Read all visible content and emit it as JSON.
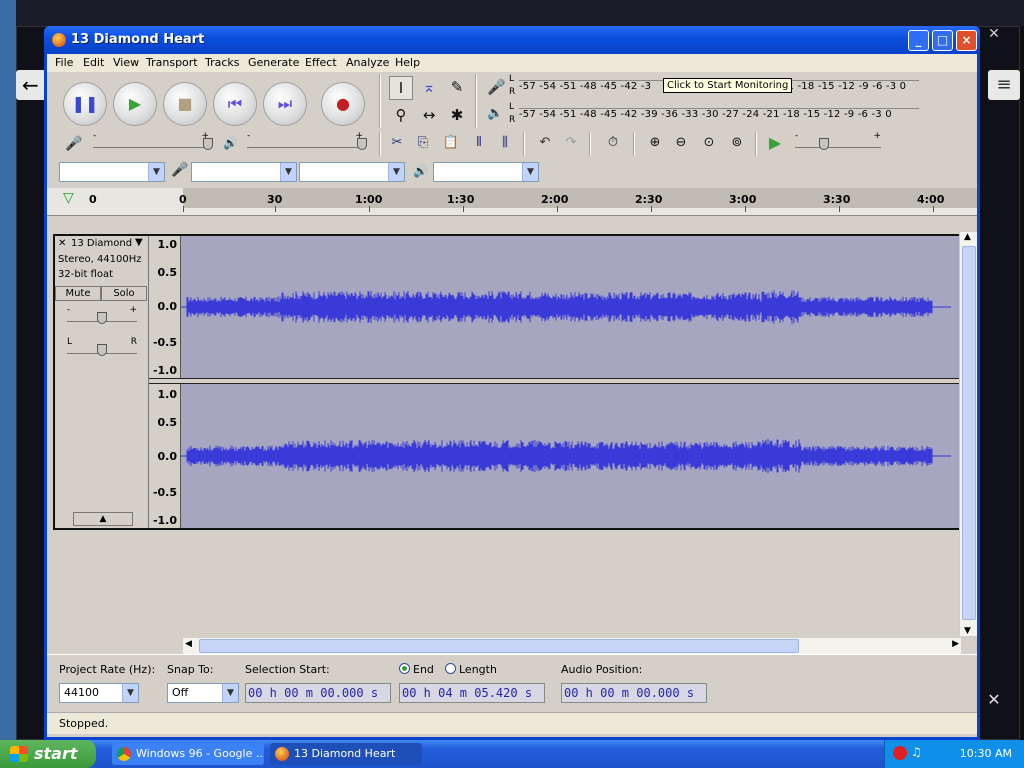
{
  "window": {
    "title": "13 Diamond Heart",
    "min_label": "_",
    "max_label": "□",
    "close_label": "×"
  },
  "menu": [
    "File",
    "Edit",
    "View",
    "Transport",
    "Tracks",
    "Generate",
    "Effect",
    "Analyze",
    "Help"
  ],
  "meters": {
    "record_scale": "-57 -54 -51 -48 -45 -42 -3",
    "record_scale_tail": "21 -18 -15 -12 -9 -6 -3 0",
    "tooltip": "Click to Start Monitoring",
    "play_scale": "-57 -54 -51 -48 -45 -42 -39 -36 -33 -30 -27 -24 -21 -18 -15 -12 -9 -6 -3 0",
    "lr_l": "L",
    "lr_r": "R"
  },
  "timeline": {
    "left_label": "0",
    "ticks": [
      "0",
      "30",
      "1:00",
      "1:30",
      "2:00",
      "2:30",
      "3:00",
      "3:30",
      "4:00"
    ]
  },
  "track": {
    "name": "13 Diamond",
    "format": "Stereo, 44100Hz",
    "bit_depth": "32-bit float",
    "mute_label": "Mute",
    "solo_label": "Solo",
    "gain_minus": "-",
    "gain_plus": "+",
    "pan_left": "L",
    "pan_right": "R",
    "scale_top": [
      "1.0",
      "0.5",
      "0.0",
      "-0.5",
      "-1.0"
    ],
    "scale_bottom": [
      "1.0",
      "0.5",
      "0.0",
      "-0.5",
      "-1.0"
    ]
  },
  "selection": {
    "project_rate_label": "Project Rate (Hz):",
    "project_rate_value": "44100",
    "snap_label": "Snap To:",
    "snap_value": "Off",
    "sel_start_label": "Selection Start:",
    "sel_start_value": "00 h 00 m 00.000 s",
    "end_label": "End",
    "length_label": "Length",
    "end_value": "00 h 04 m 05.420 s",
    "audio_pos_label": "Audio Position:",
    "audio_pos_value": "00 h 00 m 00.000 s"
  },
  "status": "Stopped.",
  "taskbar": {
    "start_label": "start",
    "tasks": [
      "Windows 96 - Google ...",
      "13 Diamond Heart"
    ],
    "clock": "10:30 AM"
  },
  "colors": {
    "titlebar": "#0a4fe0",
    "waveform": "#3434d6",
    "wave_bg": "#a6a6c0",
    "taskbar": "#245edb"
  }
}
